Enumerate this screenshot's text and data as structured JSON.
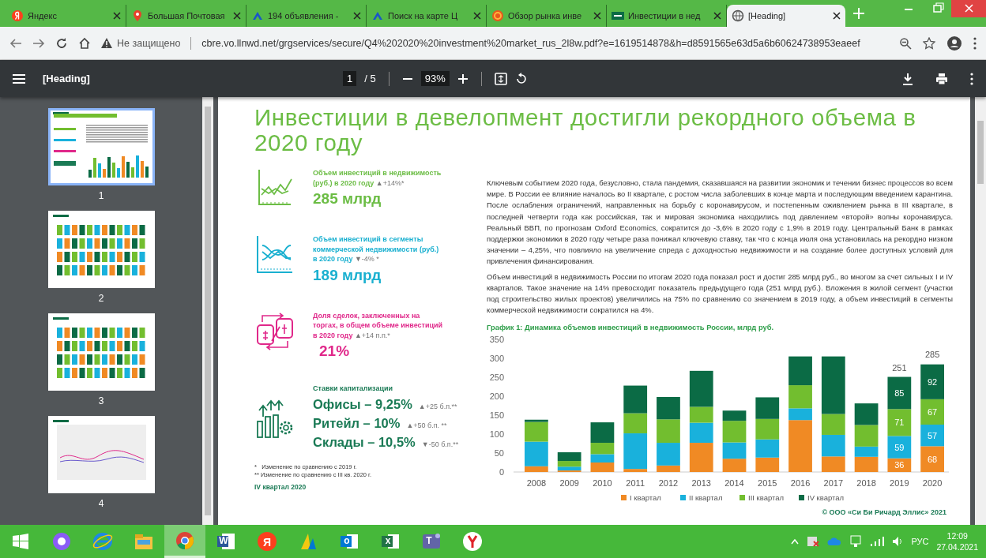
{
  "browser": {
    "tabs": [
      {
        "title": "Яндекс",
        "kind": "yandex",
        "selected": false
      },
      {
        "title": "Большая Почтовая",
        "kind": "pin",
        "selected": false
      },
      {
        "title": "194 объявления -",
        "kind": "chevron",
        "selected": false
      },
      {
        "title": "Поиск на карте Ц",
        "kind": "chevron",
        "selected": false
      },
      {
        "title": "Обзор рынка инве",
        "kind": "coin",
        "selected": false
      },
      {
        "title": "Инвестиции в нед",
        "kind": "cbre",
        "selected": false
      },
      {
        "title": "[Heading]",
        "kind": "globe",
        "selected": true
      }
    ],
    "address": {
      "security": "Не защищено",
      "url": "cbre.vo.llnwd.net/grgservices/secure/Q4%202020%20investment%20market_rus_2l8w.pdf?e=1619514878&h=d8591565e63d5a6b60624738953eaeef"
    }
  },
  "viewer": {
    "title": "[Heading]",
    "page": "1",
    "page_count": "/ 5",
    "zoom": "93%"
  },
  "thumbnails": [
    {
      "label": "1",
      "selected": true
    },
    {
      "label": "2",
      "selected": false
    },
    {
      "label": "3",
      "selected": false
    },
    {
      "label": "4",
      "selected": false
    }
  ],
  "page": {
    "title": "Инвестиции в девелопмент достигли рекордного объема в 2020 году",
    "kpis": [
      {
        "kind": "metric",
        "color": "#6cbd45",
        "label": "Объем инвестиций в недвижимость (руб.) в 2020 году",
        "change": "▲+14%*",
        "value": "285 млрд"
      },
      {
        "kind": "metric",
        "color": "#1ab0d0",
        "label": "Объем инвестиций в сегменты коммерческой недвижимости (руб.) в 2020 году",
        "change": "▼-4% *",
        "value": "189 млрд"
      },
      {
        "kind": "metric",
        "color": "#e0288a",
        "label": "Доля сделок, заключенных на торгах, в общем объеме инвестиций в 2020 году",
        "change": "▲+14 п.п.*",
        "value": "21%"
      },
      {
        "kind": "rates",
        "color": "#1a7a55",
        "label": "Ставки капитализации",
        "rows": [
          {
            "value": "Офисы – 9,25%",
            "change": "▲+25 б.п.**"
          },
          {
            "value": "Ритейл – 10%",
            "change": "▲+50 б.п. **"
          },
          {
            "value": "Склады –  10,5%",
            "change": "▼-50 б.п.**"
          }
        ]
      }
    ],
    "footnotes": [
      "*   Изменение по сравнению с 2019 г.",
      "** Изменение по сравнению с III кв. 2020 г."
    ],
    "period": "IV квартал 2020",
    "paragraphs": [
      "Ключевым событием 2020 года, безусловно, стала пандемия, сказавшаяся на развитии экономик и течении бизнес процессов во всем мире. В России ее влияние началось во II квартале, с ростом числа заболевших в конце марта и последующим введением карантина. После ослабления ограничений, направленных на борьбу с коронавирусом, и постепенным оживлением рынка в III квартале, в последней четверти года как российская, так и мировая экономика находились под давлением «второй» волны коронавируса. Реальный ВВП, по прогнозам Oxford Economics, сократится до -3,6% в 2020 году с 1,9% в 2019 году. Центральный Банк в рамках поддержки экономики в 2020 году четыре раза понижал ключевую ставку, так что с конца июля она установилась на рекордно низком значении – 4,25%, что повлияло на увеличение спреда с доходностью недвижимости и на создание более доступных условий для привлечения финансирования.",
      "Объем инвестиций в недвижимость России по итогам 2020 года показал рост и достиг 285 млрд руб., во многом за счет сильных I и IV кварталов. Такое значение на 14% превосходит показатель предыдущего года (251 млрд руб.). Вложения в жилой сегмент (участки под строительство жилых проектов) увеличились на 75% по сравнению со значением в 2019 году, а объем инвестиций в сегменты коммерческой недвижимости сократился на 4%."
    ],
    "chart_data": {
      "type": "bar",
      "title": "График 1: Динамика объемов инвестиций в недвижимость России, млрд руб.",
      "stacked": true,
      "categories": [
        "2008",
        "2009",
        "2010",
        "2011",
        "2012",
        "2013",
        "2014",
        "2015",
        "2016",
        "2017",
        "2018",
        "2019",
        "2020"
      ],
      "ylim": [
        0,
        350
      ],
      "yticks": [
        0,
        50,
        100,
        150,
        200,
        250,
        300,
        350
      ],
      "series": [
        {
          "name": "I квартал",
          "color": "#f08a24",
          "values": [
            15,
            4,
            25,
            8,
            17,
            77,
            35,
            38,
            137,
            41,
            40,
            36,
            68
          ],
          "value_labels": [
            null,
            null,
            null,
            null,
            null,
            null,
            null,
            null,
            null,
            null,
            null,
            "36",
            "68"
          ]
        },
        {
          "name": "II квартал",
          "color": "#19b1dc",
          "values": [
            65,
            10,
            22,
            94,
            60,
            53,
            43,
            48,
            31,
            57,
            27,
            59,
            57
          ],
          "value_labels": [
            null,
            null,
            null,
            null,
            null,
            null,
            null,
            null,
            null,
            null,
            null,
            "59",
            "57"
          ]
        },
        {
          "name": "III квартал",
          "color": "#72be2f",
          "values": [
            52,
            15,
            30,
            53,
            62,
            42,
            57,
            54,
            61,
            55,
            57,
            71,
            67
          ],
          "value_labels": [
            null,
            null,
            null,
            null,
            null,
            null,
            null,
            null,
            null,
            null,
            null,
            "71",
            "67"
          ]
        },
        {
          "name": "IV квартал",
          "color": "#0b6b45",
          "values": [
            6,
            23,
            54,
            73,
            59,
            95,
            27,
            57,
            76,
            152,
            57,
            85,
            92
          ],
          "value_labels": [
            null,
            null,
            null,
            null,
            null,
            null,
            null,
            null,
            null,
            null,
            null,
            "85",
            "92"
          ]
        }
      ],
      "legend": true,
      "annotations": [
        {
          "x": "2019",
          "y": 251,
          "text": "251"
        },
        {
          "x": "2020",
          "y": 285,
          "text": "285"
        }
      ]
    },
    "copyright": "© ООО «Си Би Ричард Эллис» 2021"
  },
  "taskbar": {
    "apps": [
      {
        "kind": "alice",
        "selected": false
      },
      {
        "kind": "ie",
        "selected": false
      },
      {
        "kind": "explorer",
        "selected": false
      },
      {
        "kind": "chrome",
        "selected": true
      },
      {
        "kind": "word",
        "glyph": "W",
        "selected": false
      },
      {
        "kind": "yandex",
        "glyph": "Я",
        "selected": false
      },
      {
        "kind": "dynamics",
        "selected": false
      },
      {
        "kind": "outlook",
        "glyph": "o",
        "selected": false
      },
      {
        "kind": "excel",
        "glyph": "x",
        "selected": false
      },
      {
        "kind": "teams",
        "glyph": "T",
        "selected": false
      },
      {
        "kind": "yabrowser",
        "selected": false
      }
    ],
    "language": "РУС",
    "time": "12:09",
    "date": "27.04.2021"
  }
}
